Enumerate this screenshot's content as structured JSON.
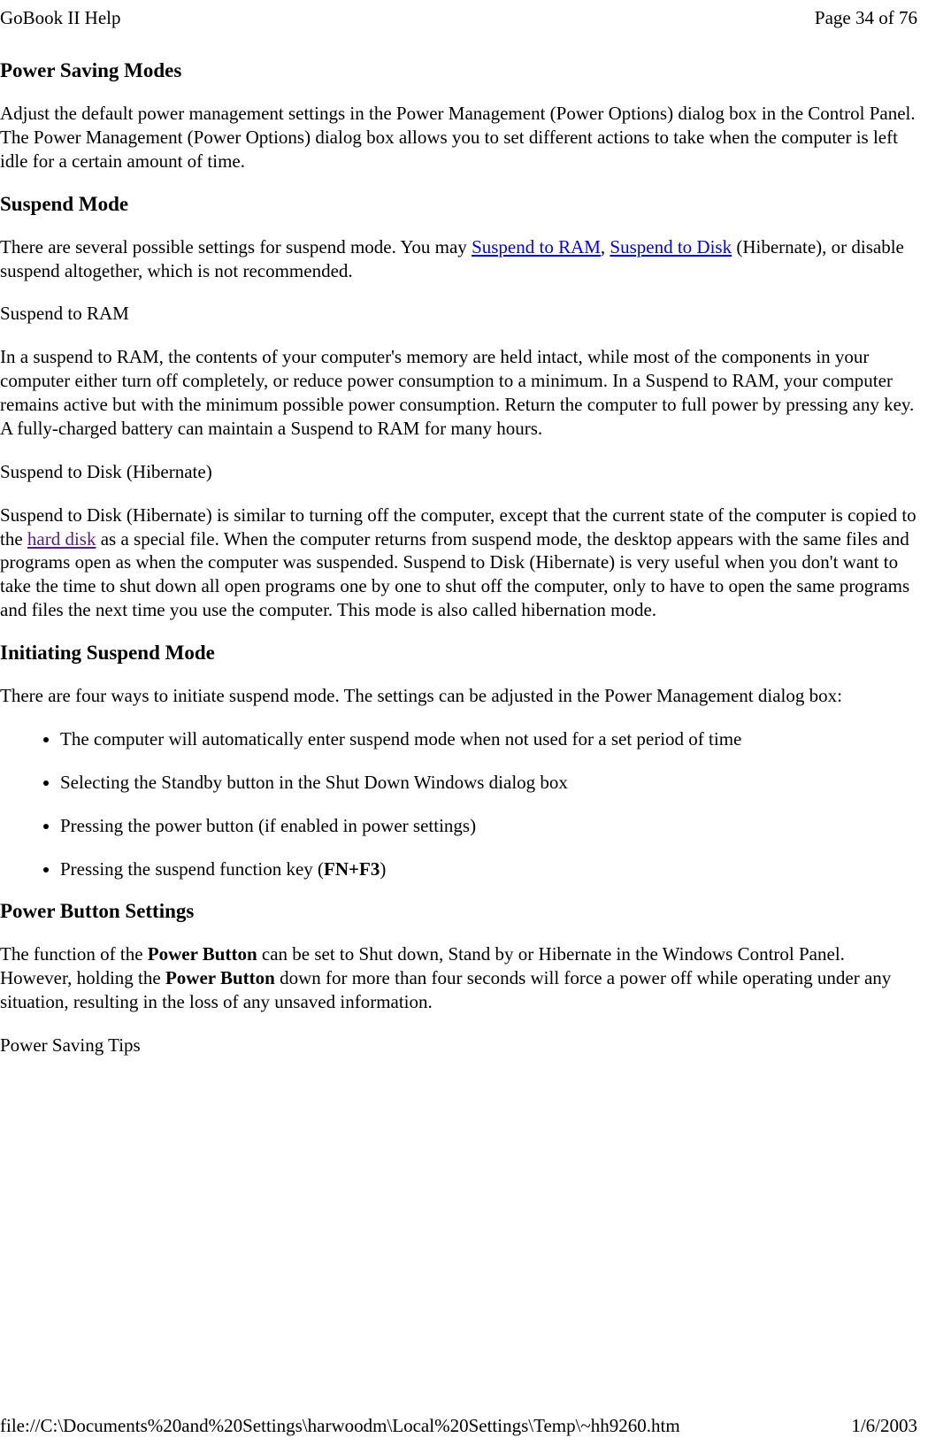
{
  "header": {
    "left": "GoBook II Help",
    "right": "Page 34 of 76"
  },
  "sections": {
    "power_saving_modes": {
      "title": "Power Saving Modes",
      "para": "Adjust the default power management settings in the Power Management (Power Options) dialog box in the Control Panel.  The Power Management (Power Options) dialog box allows you to set different actions to take when the computer is left idle for a certain amount of time."
    },
    "suspend_mode": {
      "title": "Suspend Mode",
      "para_parts": {
        "before_link1": "There are several possible settings for suspend mode.  You may ",
        "link1": "Suspend to RAM",
        "between": ", ",
        "link2": "Suspend to Disk",
        "after_link2": " (Hibernate), or disable suspend altogether, which is not recommended."
      },
      "sub_ram_title": "Suspend to RAM",
      "sub_ram_para": "In a suspend to RAM, the contents of your computer's memory are held intact, while most of the components in your computer either turn off completely, or reduce power consumption to a minimum. In a Suspend to RAM, your computer remains active but with the minimum possible power consumption. Return the computer to full power by pressing any key. A fully-charged battery can maintain a Suspend to RAM for many hours.",
      "sub_disk_title": "Suspend to Disk (Hibernate)",
      "sub_disk_para_parts": {
        "before": "Suspend to Disk (Hibernate) is similar to turning off the computer, except that the current state of the computer is copied to the ",
        "link": "hard disk",
        "after": " as a special file. When the computer returns from suspend mode, the desktop appears with the same files and programs open as when the computer was suspended. Suspend to Disk (Hibernate) is very useful when you don't want to take the time to shut down all open programs one by one to shut off the computer, only to have to open the same programs and files the next time you use the computer. This mode is also called hibernation mode."
      }
    },
    "initiating": {
      "title": "Initiating Suspend Mode",
      "intro": "There are four ways to initiate suspend mode. The settings can be adjusted in the Power Management dialog box:",
      "items": [
        "The computer will automatically enter suspend mode when not used for a set period of time",
        "Selecting the Standby button in the Shut Down Windows dialog box",
        "Pressing the power button (if enabled in power settings)"
      ],
      "item4_parts": {
        "before": "Pressing the suspend function key (",
        "bold": "FN+F3",
        "after": ")"
      }
    },
    "power_button": {
      "title": "Power Button Settings",
      "para_parts": {
        "p1": "The function of the ",
        "b1": "Power Button",
        "p2": " can be set to Shut down, Stand by or Hibernate in the Windows Control Panel.  However, holding the ",
        "b2": "Power Button",
        "p3": " down for more than four seconds will force a power off while operating under any situation, resulting in the loss of any unsaved information."
      }
    },
    "tips_title": "Power Saving Tips"
  },
  "footer": {
    "left": "file://C:\\Documents%20and%20Settings\\harwoodm\\Local%20Settings\\Temp\\~hh9260.htm",
    "right": "1/6/2003"
  }
}
